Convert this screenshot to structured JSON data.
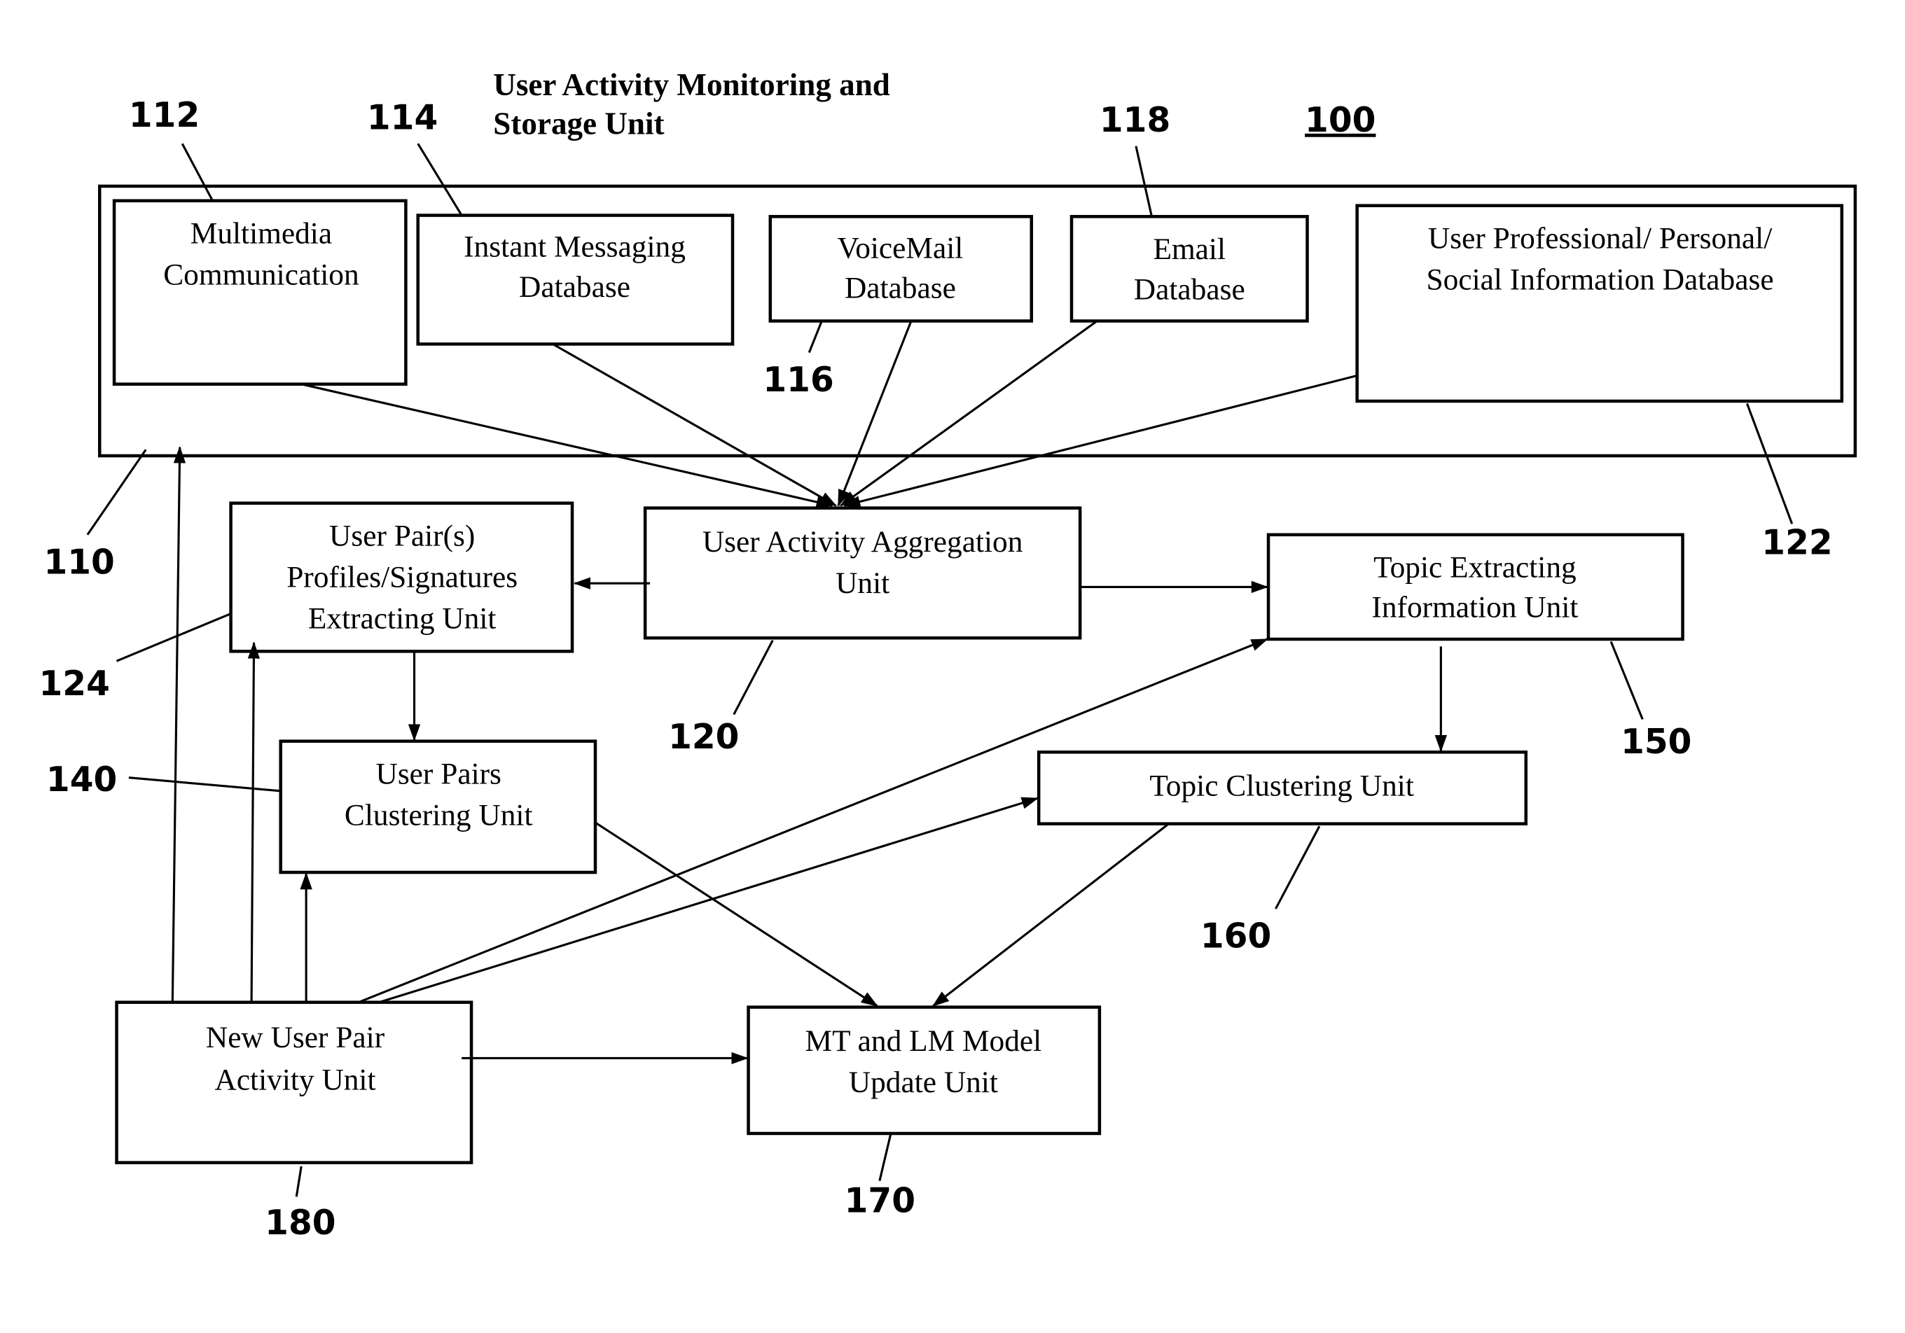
{
  "figure_ref": "100",
  "container": {
    "ref": "110",
    "title_line1": "User Activity Monitoring and",
    "title_line2": "Storage Unit"
  },
  "nodes": {
    "multimedia": {
      "ref": "112",
      "line1": "Multimedia",
      "line2": "Communication"
    },
    "im": {
      "ref": "114",
      "line1": "Instant Messaging",
      "line2": "Database"
    },
    "voicemail": {
      "ref": "116",
      "line1": "VoiceMail",
      "line2": "Database"
    },
    "email": {
      "ref": "118",
      "line1": "Email",
      "line2": "Database"
    },
    "userinfo": {
      "ref": "122",
      "line1": "User Professional/ Personal/",
      "line2": "Social Information Database"
    },
    "aggregation": {
      "ref": "120",
      "line1": "User Activity Aggregation",
      "line2": "Unit"
    },
    "profiles": {
      "ref": "124",
      "line1": "User Pair(s)",
      "line2": "Profiles/Signatures",
      "line3": "Extracting Unit"
    },
    "pairs_clustering": {
      "ref": "140",
      "line1": "User Pairs",
      "line2": "Clustering Unit"
    },
    "topic_extracting": {
      "ref": "150",
      "line1": "Topic Extracting",
      "line2": "Information Unit"
    },
    "topic_clustering": {
      "ref": "160",
      "line1": "Topic Clustering Unit"
    },
    "model_update": {
      "ref": "170",
      "line1": "MT and LM Model",
      "line2": "Update Unit"
    },
    "new_pair": {
      "ref": "180",
      "line1": "New User Pair",
      "line2": "Activity Unit"
    }
  },
  "edges": [
    {
      "from": "multimedia",
      "to": "aggregation"
    },
    {
      "from": "im",
      "to": "aggregation"
    },
    {
      "from": "voicemail",
      "to": "aggregation"
    },
    {
      "from": "email",
      "to": "aggregation"
    },
    {
      "from": "userinfo",
      "to": "aggregation"
    },
    {
      "from": "aggregation",
      "to": "profiles"
    },
    {
      "from": "aggregation",
      "to": "topic_extracting"
    },
    {
      "from": "profiles",
      "to": "pairs_clustering"
    },
    {
      "from": "topic_extracting",
      "to": "topic_clustering"
    },
    {
      "from": "pairs_clustering",
      "to": "model_update"
    },
    {
      "from": "topic_clustering",
      "to": "model_update"
    },
    {
      "from": "new_pair",
      "to": "container"
    },
    {
      "from": "new_pair",
      "to": "profiles"
    },
    {
      "from": "new_pair",
      "to": "pairs_clustering"
    },
    {
      "from": "new_pair",
      "to": "topic_extracting"
    },
    {
      "from": "new_pair",
      "to": "topic_clustering"
    },
    {
      "from": "new_pair",
      "to": "model_update"
    }
  ]
}
